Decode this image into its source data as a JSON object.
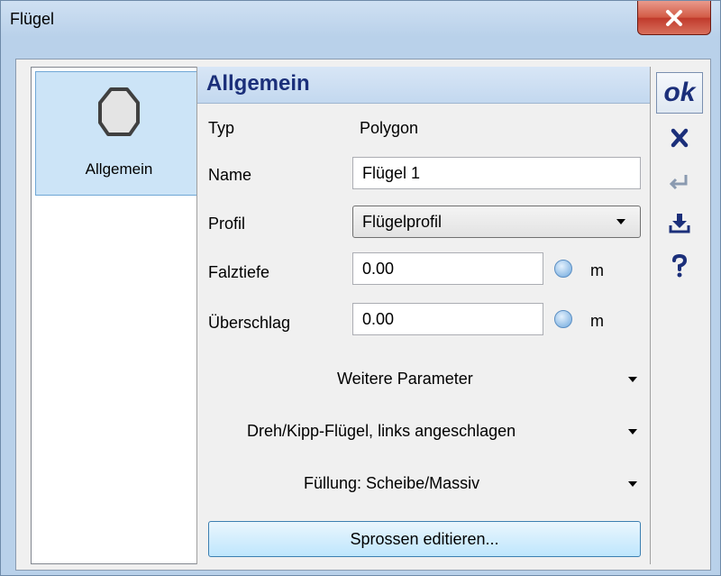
{
  "window": {
    "title": "Flügel"
  },
  "nav": {
    "items": [
      {
        "label": "Allgemein",
        "icon": "octagon-icon"
      }
    ]
  },
  "panel": {
    "header": "Allgemein",
    "fields": {
      "typ": {
        "label": "Typ",
        "value": "Polygon"
      },
      "name": {
        "label": "Name",
        "value": "Flügel 1"
      },
      "profil": {
        "label": "Profil",
        "value": "Flügelprofil"
      },
      "falztiefe": {
        "label": "Falztiefe",
        "value": "0.00",
        "unit": "m"
      },
      "ueberschlag": {
        "label": "Überschlag",
        "value": "0.00",
        "unit": "m"
      }
    },
    "sections": [
      "Weitere Parameter",
      "Dreh/Kipp-Flügel, links angeschlagen",
      "Füllung: Scheibe/Massiv"
    ],
    "button_label": "Sprossen editieren..."
  },
  "toolbar": {
    "ok_label": "ok"
  },
  "colors": {
    "accent": "#1b2f7a",
    "close": "#c0392b",
    "selection": "#cce4f7"
  }
}
